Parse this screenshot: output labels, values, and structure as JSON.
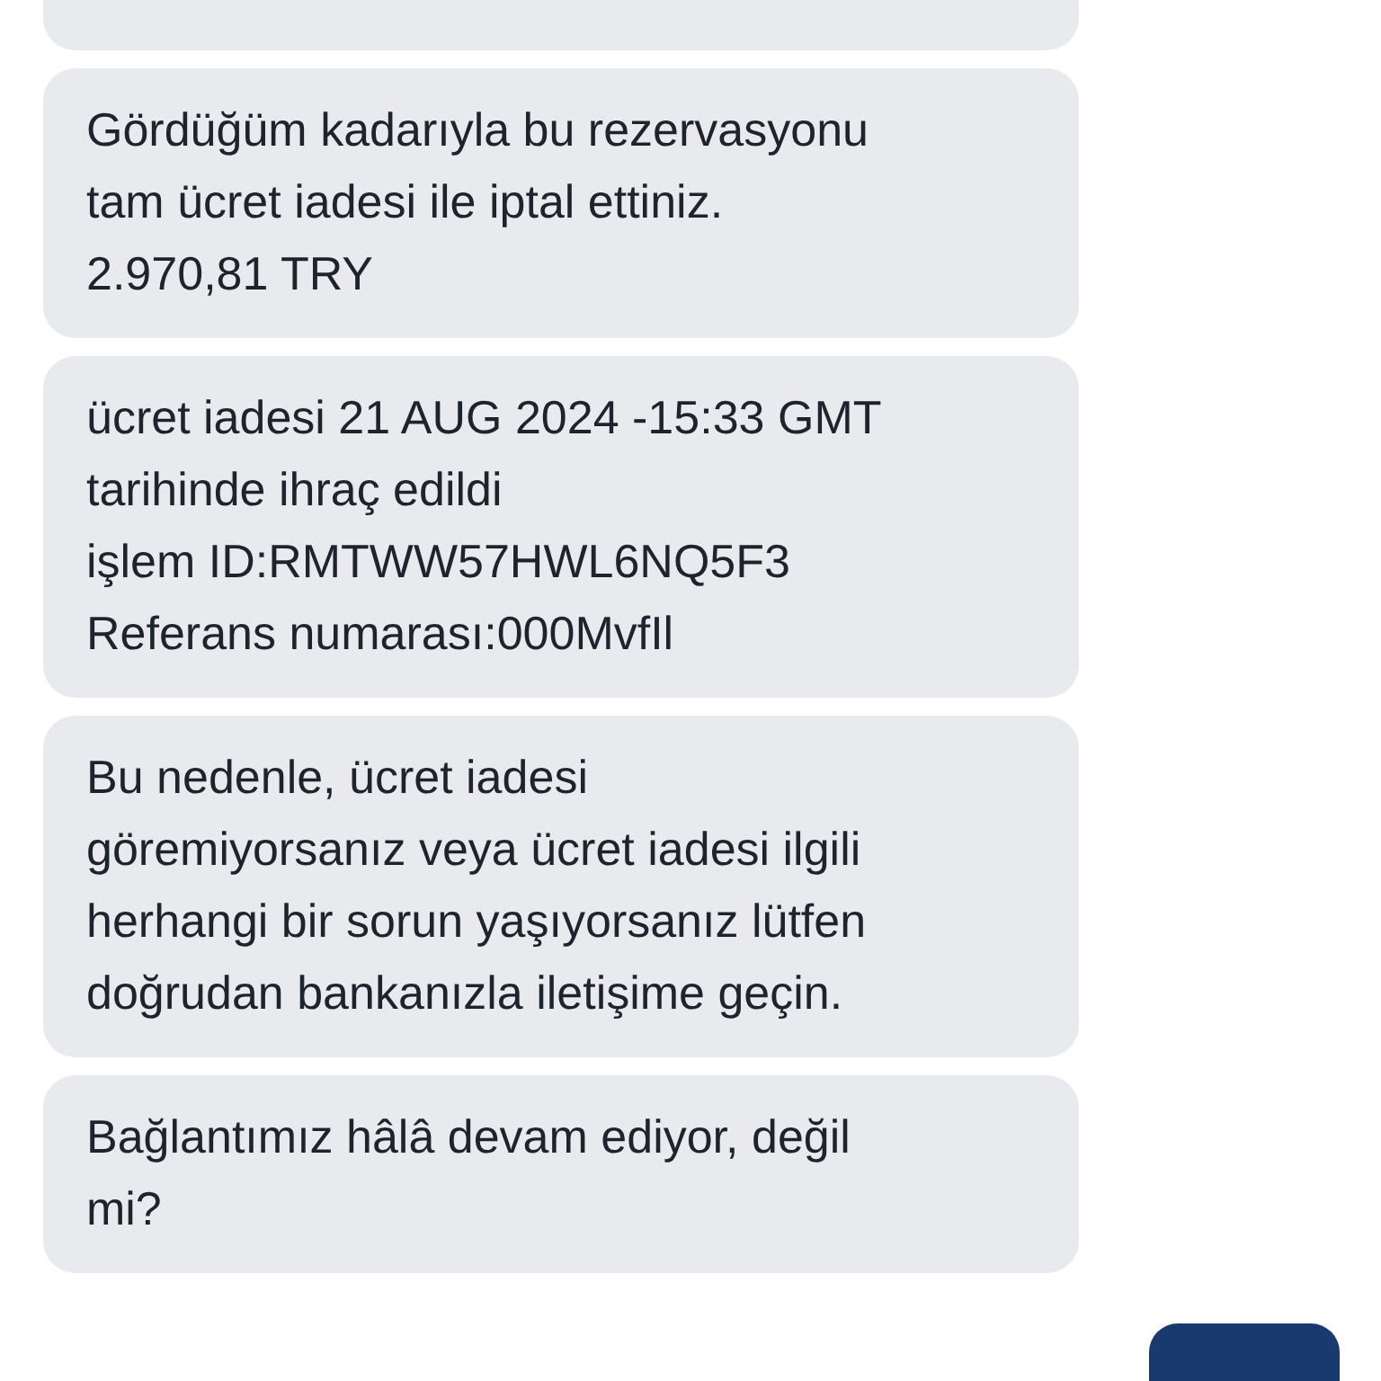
{
  "messages": [
    {
      "text": "Gördüğüm kadarıyla bu rezervasyonu\ntam ücret iadesi ile iptal ettiniz.\n2.970,81 TRY"
    },
    {
      "text": "ücret iadesi 21 AUG 2024 -15:33 GMT\ntarihinde ihraç edildi\nişlem ID:RMTWW57HWL6NQ5F3\nReferans numarası:000MvfIl"
    },
    {
      "text": "Bu nedenle, ücret iadesi\ngöremiyorsanız veya ücret iadesi ilgili\nherhangi bir sorun yaşıyorsanız lütfen\ndoğrudan bankanızla iletişime geçin."
    },
    {
      "text": "Bağlantımız hâlâ devam ediyor, değil\nmi?"
    }
  ]
}
